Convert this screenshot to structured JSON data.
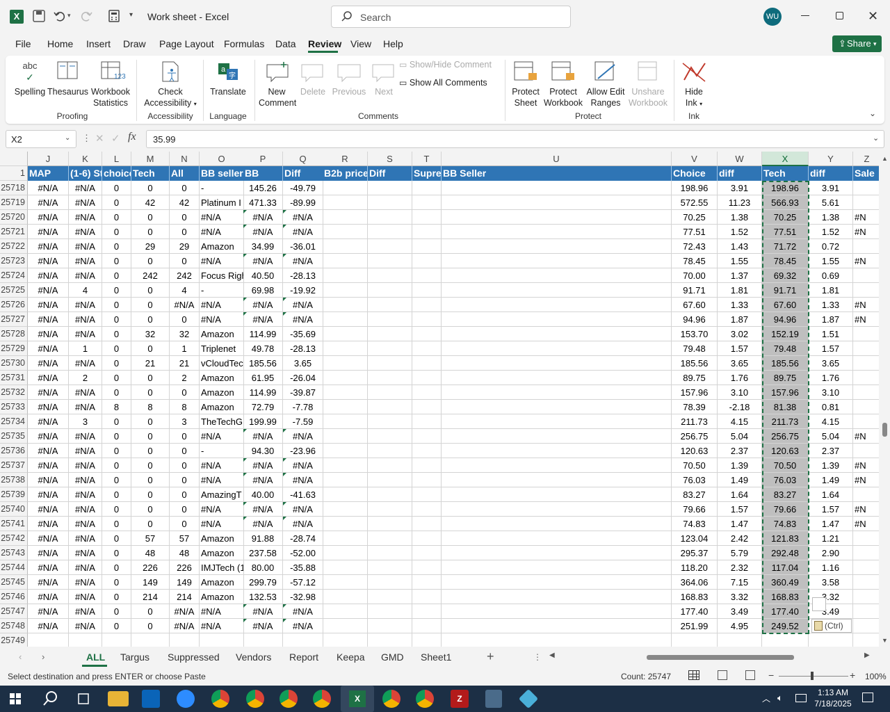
{
  "app": {
    "title": "Work sheet  -  Excel",
    "search_placeholder": "Search",
    "user_initials": "WU",
    "share_label": "Share"
  },
  "menu": [
    "File",
    "Home",
    "Insert",
    "Draw",
    "Page Layout",
    "Formulas",
    "Data",
    "Review",
    "View",
    "Help"
  ],
  "active_menu": "Review",
  "ribbon": {
    "spelling": "Spelling",
    "thesaurus": "Thesaurus",
    "workbook": "Workbook",
    "statistics": "Statistics",
    "check": "Check",
    "accessibility_btn": "Accessibility",
    "translate": "Translate",
    "new": "New",
    "comment": "Comment",
    "delete": "Delete",
    "previous": "Previous",
    "next": "Next",
    "show_hide_comment": "Show/Hide Comment",
    "show_all_comments": "Show All Comments",
    "protect": "Protect",
    "sheet": "Sheet",
    "protect2": "Protect",
    "workbook2": "Workbook",
    "allow_edit": "Allow Edit",
    "ranges": "Ranges",
    "unshare": "Unshare",
    "workbook3": "Workbook",
    "hide": "Hide",
    "ink": "Ink",
    "groups": {
      "proofing": "Proofing",
      "accessibility": "Accessibility",
      "language": "Language",
      "comments": "Comments",
      "protect": "Protect",
      "ink": "Ink"
    }
  },
  "formula_bar": {
    "name_box": "X2",
    "fx": "fx",
    "value": "35.99"
  },
  "columns": [
    "J",
    "K",
    "L",
    "M",
    "N",
    "O",
    "P",
    "Q",
    "R",
    "S",
    "T",
    "U",
    "V",
    "W",
    "X",
    "Y",
    "Z"
  ],
  "header_row_num": "1",
  "headers": [
    "MAP",
    "(1-6) St",
    "choice",
    "Tech",
    "All",
    "BB sellers",
    "BB",
    "Diff",
    "B2b price",
    "Diff",
    "Supre",
    "BB Seller",
    "Choice",
    "diff",
    "Tech",
    "diff",
    "Sale"
  ],
  "rows": [
    {
      "n": "25718",
      "v": [
        "#N/A",
        "#N/A",
        "0",
        "0",
        "0",
        "-",
        "145.26",
        "-49.79",
        "",
        "",
        "",
        "",
        "198.96",
        "3.91",
        "198.96",
        "3.91",
        ""
      ]
    },
    {
      "n": "25719",
      "v": [
        "#N/A",
        "#N/A",
        "0",
        "42",
        "42",
        "Platinum I",
        "471.33",
        "-89.99",
        "",
        "",
        "",
        "",
        "572.55",
        "11.23",
        "566.93",
        "5.61",
        ""
      ]
    },
    {
      "n": "25720",
      "v": [
        "#N/A",
        "#N/A",
        "0",
        "0",
        "0",
        "#N/A",
        "#N/A",
        "#N/A",
        "",
        "",
        "",
        "",
        "70.25",
        "1.38",
        "70.25",
        "1.38",
        "#N"
      ]
    },
    {
      "n": "25721",
      "v": [
        "#N/A",
        "#N/A",
        "0",
        "0",
        "0",
        "#N/A",
        "#N/A",
        "#N/A",
        "",
        "",
        "",
        "",
        "77.51",
        "1.52",
        "77.51",
        "1.52",
        "#N"
      ]
    },
    {
      "n": "25722",
      "v": [
        "#N/A",
        "#N/A",
        "0",
        "29",
        "29",
        "Amazon",
        "34.99",
        "-36.01",
        "",
        "",
        "",
        "",
        "72.43",
        "1.43",
        "71.72",
        "0.72",
        ""
      ]
    },
    {
      "n": "25723",
      "v": [
        "#N/A",
        "#N/A",
        "0",
        "0",
        "0",
        "#N/A",
        "#N/A",
        "#N/A",
        "",
        "",
        "",
        "",
        "78.45",
        "1.55",
        "78.45",
        "1.55",
        "#N"
      ]
    },
    {
      "n": "25724",
      "v": [
        "#N/A",
        "#N/A",
        "0",
        "242",
        "242",
        "Focus Righ",
        "40.50",
        "-28.13",
        "",
        "",
        "",
        "",
        "70.00",
        "1.37",
        "69.32",
        "0.69",
        ""
      ]
    },
    {
      "n": "25725",
      "v": [
        "#N/A",
        "4",
        "0",
        "0",
        "4",
        "-",
        "69.98",
        "-19.92",
        "",
        "",
        "",
        "",
        "91.71",
        "1.81",
        "91.71",
        "1.81",
        ""
      ]
    },
    {
      "n": "25726",
      "v": [
        "#N/A",
        "#N/A",
        "0",
        "0",
        "#N/A",
        "#N/A",
        "#N/A",
        "#N/A",
        "",
        "",
        "",
        "",
        "67.60",
        "1.33",
        "67.60",
        "1.33",
        "#N"
      ]
    },
    {
      "n": "25727",
      "v": [
        "#N/A",
        "#N/A",
        "0",
        "0",
        "0",
        "#N/A",
        "#N/A",
        "#N/A",
        "",
        "",
        "",
        "",
        "94.96",
        "1.87",
        "94.96",
        "1.87",
        "#N"
      ]
    },
    {
      "n": "25728",
      "v": [
        "#N/A",
        "#N/A",
        "0",
        "32",
        "32",
        "Amazon",
        "114.99",
        "-35.69",
        "",
        "",
        "",
        "",
        "153.70",
        "3.02",
        "152.19",
        "1.51",
        ""
      ]
    },
    {
      "n": "25729",
      "v": [
        "#N/A",
        "1",
        "0",
        "0",
        "1",
        "Triplenet",
        "49.78",
        "-28.13",
        "",
        "",
        "",
        "",
        "79.48",
        "1.57",
        "79.48",
        "1.57",
        ""
      ]
    },
    {
      "n": "25730",
      "v": [
        "#N/A",
        "#N/A",
        "0",
        "21",
        "21",
        "vCloudTec",
        "185.56",
        "3.65",
        "",
        "",
        "",
        "",
        "185.56",
        "3.65",
        "185.56",
        "3.65",
        ""
      ]
    },
    {
      "n": "25731",
      "v": [
        "#N/A",
        "2",
        "0",
        "0",
        "2",
        "Amazon",
        "61.95",
        "-26.04",
        "",
        "",
        "",
        "",
        "89.75",
        "1.76",
        "89.75",
        "1.76",
        ""
      ]
    },
    {
      "n": "25732",
      "v": [
        "#N/A",
        "#N/A",
        "0",
        "0",
        "0",
        "Amazon",
        "114.99",
        "-39.87",
        "",
        "",
        "",
        "",
        "157.96",
        "3.10",
        "157.96",
        "3.10",
        ""
      ]
    },
    {
      "n": "25733",
      "v": [
        "#N/A",
        "#N/A",
        "8",
        "8",
        "8",
        "Amazon",
        "72.79",
        "-7.78",
        "",
        "",
        "",
        "",
        "78.39",
        "-2.18",
        "81.38",
        "0.81",
        ""
      ]
    },
    {
      "n": "25734",
      "v": [
        "#N/A",
        "3",
        "0",
        "0",
        "3",
        "TheTechG",
        "199.99",
        "-7.59",
        "",
        "",
        "",
        "",
        "211.73",
        "4.15",
        "211.73",
        "4.15",
        ""
      ]
    },
    {
      "n": "25735",
      "v": [
        "#N/A",
        "#N/A",
        "0",
        "0",
        "0",
        "#N/A",
        "#N/A",
        "#N/A",
        "",
        "",
        "",
        "",
        "256.75",
        "5.04",
        "256.75",
        "5.04",
        "#N"
      ]
    },
    {
      "n": "25736",
      "v": [
        "#N/A",
        "#N/A",
        "0",
        "0",
        "0",
        "-",
        "94.30",
        "-23.96",
        "",
        "",
        "",
        "",
        "120.63",
        "2.37",
        "120.63",
        "2.37",
        ""
      ]
    },
    {
      "n": "25737",
      "v": [
        "#N/A",
        "#N/A",
        "0",
        "0",
        "0",
        "#N/A",
        "#N/A",
        "#N/A",
        "",
        "",
        "",
        "",
        "70.50",
        "1.39",
        "70.50",
        "1.39",
        "#N"
      ]
    },
    {
      "n": "25738",
      "v": [
        "#N/A",
        "#N/A",
        "0",
        "0",
        "0",
        "#N/A",
        "#N/A",
        "#N/A",
        "",
        "",
        "",
        "",
        "76.03",
        "1.49",
        "76.03",
        "1.49",
        "#N"
      ]
    },
    {
      "n": "25739",
      "v": [
        "#N/A",
        "#N/A",
        "0",
        "0",
        "0",
        "AmazingT",
        "40.00",
        "-41.63",
        "",
        "",
        "",
        "",
        "83.27",
        "1.64",
        "83.27",
        "1.64",
        ""
      ]
    },
    {
      "n": "25740",
      "v": [
        "#N/A",
        "#N/A",
        "0",
        "0",
        "0",
        "#N/A",
        "#N/A",
        "#N/A",
        "",
        "",
        "",
        "",
        "79.66",
        "1.57",
        "79.66",
        "1.57",
        "#N"
      ]
    },
    {
      "n": "25741",
      "v": [
        "#N/A",
        "#N/A",
        "0",
        "0",
        "0",
        "#N/A",
        "#N/A",
        "#N/A",
        "",
        "",
        "",
        "",
        "74.83",
        "1.47",
        "74.83",
        "1.47",
        "#N"
      ]
    },
    {
      "n": "25742",
      "v": [
        "#N/A",
        "#N/A",
        "0",
        "57",
        "57",
        "Amazon",
        "91.88",
        "-28.74",
        "",
        "",
        "",
        "",
        "123.04",
        "2.42",
        "121.83",
        "1.21",
        ""
      ]
    },
    {
      "n": "25743",
      "v": [
        "#N/A",
        "#N/A",
        "0",
        "48",
        "48",
        "Amazon",
        "237.58",
        "-52.00",
        "",
        "",
        "",
        "",
        "295.37",
        "5.79",
        "292.48",
        "2.90",
        ""
      ]
    },
    {
      "n": "25744",
      "v": [
        "#N/A",
        "#N/A",
        "0",
        "226",
        "226",
        "IMJTech (1",
        "80.00",
        "-35.88",
        "",
        "",
        "",
        "",
        "118.20",
        "2.32",
        "117.04",
        "1.16",
        ""
      ]
    },
    {
      "n": "25745",
      "v": [
        "#N/A",
        "#N/A",
        "0",
        "149",
        "149",
        "Amazon",
        "299.79",
        "-57.12",
        "",
        "",
        "",
        "",
        "364.06",
        "7.15",
        "360.49",
        "3.58",
        ""
      ]
    },
    {
      "n": "25746",
      "v": [
        "#N/A",
        "#N/A",
        "0",
        "214",
        "214",
        "Amazon",
        "132.53",
        "-32.98",
        "",
        "",
        "",
        "",
        "168.83",
        "3.32",
        "168.83",
        "3.32",
        ""
      ]
    },
    {
      "n": "25747",
      "v": [
        "#N/A",
        "#N/A",
        "0",
        "0",
        "#N/A",
        "#N/A",
        "#N/A",
        "#N/A",
        "",
        "",
        "",
        "",
        "177.40",
        "3.49",
        "177.40",
        "3.49",
        ""
      ]
    },
    {
      "n": "25748",
      "v": [
        "#N/A",
        "#N/A",
        "0",
        "0",
        "#N/A",
        "#N/A",
        "#N/A",
        "#N/A",
        "",
        "",
        "",
        "",
        "251.99",
        "4.95",
        "249.52",
        "",
        ""
      ]
    }
  ],
  "last_row_num": "25749",
  "paste_ctrl": "(Ctrl)",
  "sheet_tabs": [
    "ALL",
    "Targus",
    "Suppressed",
    "Vendors",
    "Report",
    "Keepa",
    "GMD",
    "Sheet1"
  ],
  "active_tab": "ALL",
  "status": {
    "message": "Select destination and press ENTER or choose Paste",
    "count": "Count: 25747",
    "zoom": "100%"
  },
  "taskbar": {
    "time": "1:13 AM",
    "date": "7/18/2025"
  },
  "colors": {
    "excel_green": "#1e7145",
    "header_blue": "#2f75b5",
    "selected_col": "#bfbfbf"
  }
}
